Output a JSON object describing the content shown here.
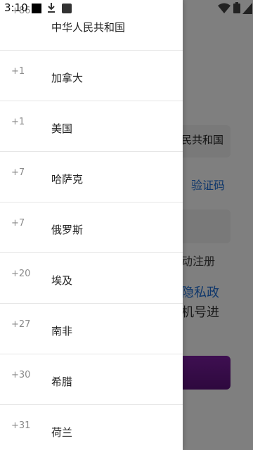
{
  "status_bar": {
    "time": "3:10",
    "icons": [
      "notification-square-icon",
      "download-icon",
      "a-icon",
      "wifi-icon",
      "battery-icon",
      "signal-icon"
    ]
  },
  "background": {
    "country_value": "民共和国",
    "verify_code_link": "验证码",
    "auto_register_text": "动注册",
    "privacy_link": "隐私政",
    "phone_text": "机号进"
  },
  "countries": [
    {
      "code": "+86",
      "name": "中华人民共和国"
    },
    {
      "code": "+1",
      "name": "加拿大"
    },
    {
      "code": "+1",
      "name": "美国"
    },
    {
      "code": "+7",
      "name": "哈萨克"
    },
    {
      "code": "+7",
      "name": "俄罗斯"
    },
    {
      "code": "+20",
      "name": "埃及"
    },
    {
      "code": "+27",
      "name": "南非"
    },
    {
      "code": "+30",
      "name": "希腊"
    },
    {
      "code": "+31",
      "name": "荷兰"
    }
  ],
  "colors": {
    "accent": "#1f6fd6",
    "button": "#6a1a8e",
    "scrim": "rgba(0,0,0,0.5)"
  }
}
